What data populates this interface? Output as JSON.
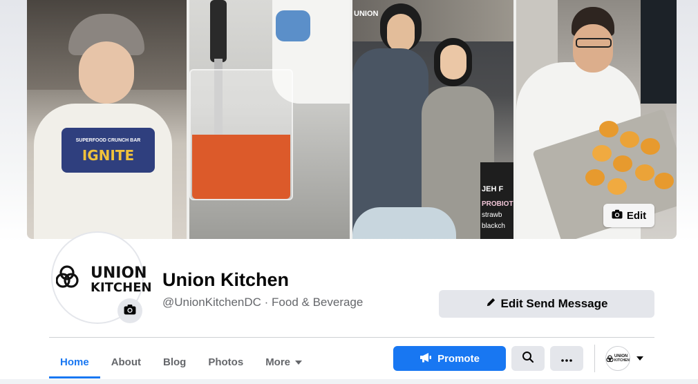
{
  "cover": {
    "edit_label": "Edit",
    "panel_texts": {
      "bar_brand": "IGNITE",
      "bar_tagline": "SUPERFOOD CRUNCH BAR",
      "sign_lines": [
        "JEH F",
        "PROBIOTI",
        "strawb",
        "blackch"
      ],
      "shop_sign": "UNION"
    }
  },
  "profile": {
    "logo_top": "UNION",
    "logo_bottom": "KITCHEN",
    "name": "Union Kitchen",
    "subtitle": "@UnionKitchenDC · Food & Beverage",
    "edit_send_label": "Edit Send Message"
  },
  "tabs": [
    {
      "label": "Home",
      "active": true
    },
    {
      "label": "About",
      "active": false
    },
    {
      "label": "Blog",
      "active": false
    },
    {
      "label": "Photos",
      "active": false
    },
    {
      "label": "More",
      "active": false
    }
  ],
  "actions": {
    "promote_label": "Promote",
    "account_logo_top": "UNION",
    "account_logo_bottom": "KITCHEN"
  },
  "colors": {
    "accent": "#1877f2",
    "button_gray": "#e4e6eb",
    "text_secondary": "#65676b"
  },
  "icons": [
    "camera-icon",
    "pencil-icon",
    "megaphone-icon",
    "search-icon",
    "ellipsis-icon",
    "caret-down-icon"
  ]
}
